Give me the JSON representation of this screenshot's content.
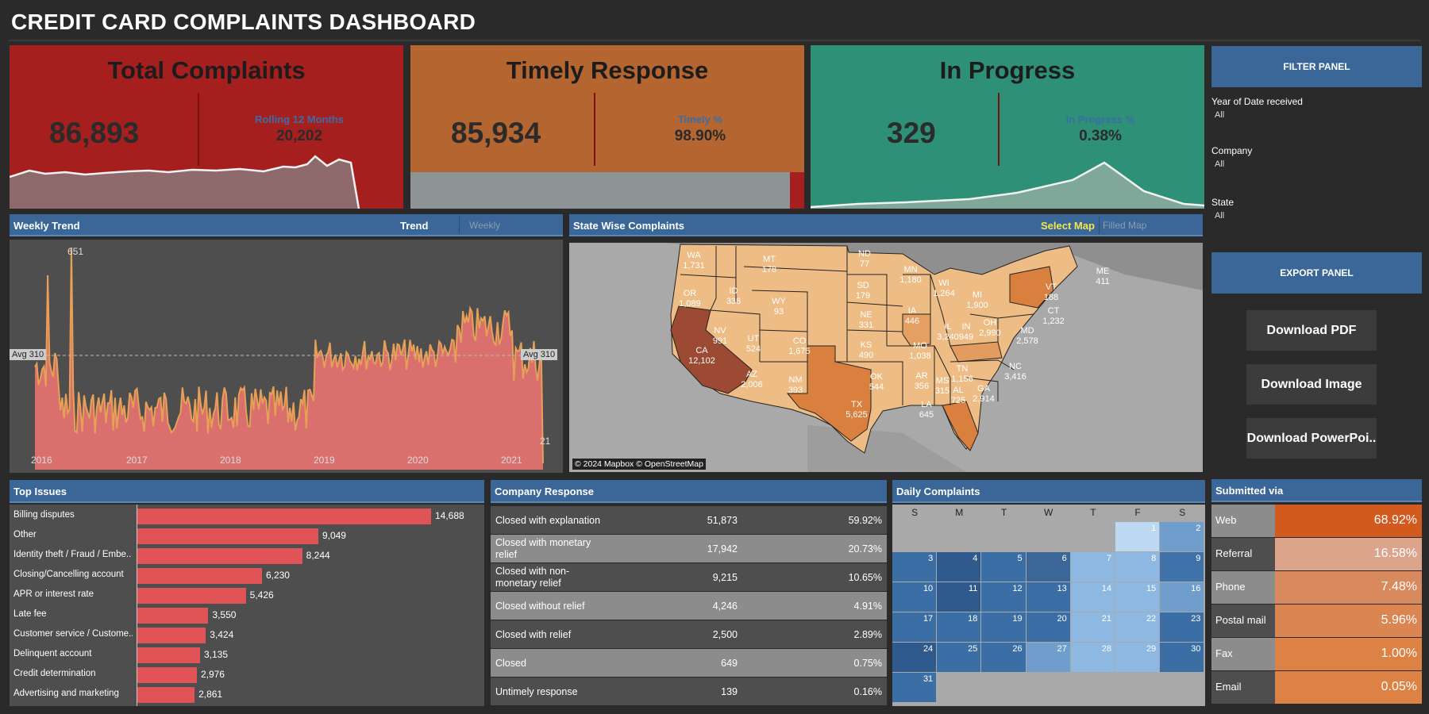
{
  "title": "CREDIT CARD COMPLAINTS DASHBOARD",
  "kpis": {
    "total": {
      "title": "Total Complaints",
      "value": "86,893",
      "sub_label": "Rolling 12 Months",
      "sub_value": "20,202",
      "color": "#a51f1f"
    },
    "timely": {
      "title": "Timely Response",
      "value": "85,934",
      "sub_label": "Timely %",
      "sub_value": "98.90%",
      "color": "#b5652f",
      "bar_fraction": 0.989
    },
    "progress": {
      "title": "In Progress",
      "value": "329",
      "sub_label": "In Progress %",
      "sub_value": "0.38%",
      "color": "#2e9076"
    }
  },
  "weekly": {
    "header": "Weekly Trend",
    "trend_label": "Trend",
    "trend_value": "Weekly",
    "peak_label": "651",
    "avg_label_left": "Avg 310",
    "avg_label_right": "Avg 310",
    "end_label": "21",
    "years": [
      "2016",
      "2017",
      "2018",
      "2019",
      "2020",
      "2021"
    ]
  },
  "state_map": {
    "header": "State Wise Complaints",
    "select_label": "Select Map",
    "select_value": "Filled Map",
    "attribution": "© 2024 Mapbox © OpenStreetMap",
    "states": [
      {
        "abbr": "WA",
        "value": "1,731"
      },
      {
        "abbr": "OR",
        "value": "1,089"
      },
      {
        "abbr": "CA",
        "value": "12,102"
      },
      {
        "abbr": "ID",
        "value": "336"
      },
      {
        "abbr": "NV",
        "value": "991"
      },
      {
        "abbr": "MT",
        "value": "178"
      },
      {
        "abbr": "WY",
        "value": "93"
      },
      {
        "abbr": "UT",
        "value": "524"
      },
      {
        "abbr": "AZ",
        "value": "2,006"
      },
      {
        "abbr": "CO",
        "value": "1,675"
      },
      {
        "abbr": "NM",
        "value": "393"
      },
      {
        "abbr": "ND",
        "value": "77"
      },
      {
        "abbr": "SD",
        "value": "179"
      },
      {
        "abbr": "NE",
        "value": "331"
      },
      {
        "abbr": "KS",
        "value": "490"
      },
      {
        "abbr": "OK",
        "value": "544"
      },
      {
        "abbr": "TX",
        "value": "5,625"
      },
      {
        "abbr": "MN",
        "value": "1,180"
      },
      {
        "abbr": "IA",
        "value": "446"
      },
      {
        "abbr": "MO",
        "value": "1,038"
      },
      {
        "abbr": "AR",
        "value": "356"
      },
      {
        "abbr": "LA",
        "value": "645"
      },
      {
        "abbr": "WI",
        "value": "1,264"
      },
      {
        "abbr": "IL",
        "value": "3,240"
      },
      {
        "abbr": "MI",
        "value": "1,900"
      },
      {
        "abbr": "IN",
        "value": "949"
      },
      {
        "abbr": "OH",
        "value": "2,990"
      },
      {
        "abbr": "TN",
        "value": "1,156"
      },
      {
        "abbr": "MS",
        "value": "315"
      },
      {
        "abbr": "AL",
        "value": "725"
      },
      {
        "abbr": "GA",
        "value": "2,914"
      },
      {
        "abbr": "NC",
        "value": "3,416"
      },
      {
        "abbr": "MD",
        "value": "2,578"
      },
      {
        "abbr": "VT",
        "value": "188"
      },
      {
        "abbr": "CT",
        "value": "1,232"
      },
      {
        "abbr": "ME",
        "value": "411"
      }
    ]
  },
  "filter_panel": {
    "header": "FILTER PANEL",
    "filters": [
      {
        "label": "Year of Date received",
        "value": "All"
      },
      {
        "label": "Company",
        "value": "All"
      },
      {
        "label": "State",
        "value": "All"
      }
    ]
  },
  "export_panel": {
    "header": "EXPORT PANEL",
    "buttons": [
      "Download PDF",
      "Download Image",
      "Download PowerPoi.."
    ]
  },
  "top_issues": {
    "header": "Top Issues",
    "rows": [
      {
        "label": "Billing disputes",
        "value": 14688,
        "text": "14,688"
      },
      {
        "label": "Other",
        "value": 9049,
        "text": "9,049"
      },
      {
        "label": "Identity theft / Fraud / Embe..",
        "value": 8244,
        "text": "8,244"
      },
      {
        "label": "Closing/Cancelling account",
        "value": 6230,
        "text": "6,230"
      },
      {
        "label": "APR or interest rate",
        "value": 5426,
        "text": "5,426"
      },
      {
        "label": "Late fee",
        "value": 3550,
        "text": "3,550"
      },
      {
        "label": "Customer service / Custome..",
        "value": 3424,
        "text": "3,424"
      },
      {
        "label": "Delinquent account",
        "value": 3135,
        "text": "3,135"
      },
      {
        "label": "Credit determination",
        "value": 2976,
        "text": "2,976"
      },
      {
        "label": "Advertising and marketing",
        "value": 2861,
        "text": "2,861"
      }
    ]
  },
  "company_response": {
    "header": "Company Response",
    "rows": [
      {
        "label": "Closed with explanation",
        "count": "51,873",
        "pct": "59.92%"
      },
      {
        "label": "Closed with monetary relief",
        "count": "17,942",
        "pct": "20.73%"
      },
      {
        "label": "Closed with non-monetary relief",
        "count": "9,215",
        "pct": "10.65%"
      },
      {
        "label": "Closed without relief",
        "count": "4,246",
        "pct": "4.91%"
      },
      {
        "label": "Closed with relief",
        "count": "2,500",
        "pct": "2.89%"
      },
      {
        "label": "Closed",
        "count": "649",
        "pct": "0.75%"
      },
      {
        "label": "Untimely response",
        "count": "139",
        "pct": "0.16%"
      }
    ]
  },
  "daily": {
    "header": "Daily Complaints",
    "weekdays": [
      "S",
      "M",
      "T",
      "W",
      "T",
      "F",
      "S"
    ],
    "days": [
      "1",
      "2",
      "3",
      "4",
      "5",
      "6",
      "7",
      "8",
      "9",
      "10",
      "11",
      "12",
      "13",
      "14",
      "15",
      "16",
      "17",
      "18",
      "19",
      "20",
      "21",
      "22",
      "23",
      "24",
      "25",
      "26",
      "27",
      "28",
      "29",
      "30",
      "31"
    ]
  },
  "submitted": {
    "header": "Submitted via",
    "rows": [
      {
        "label": "Web",
        "pct": "68.92%",
        "color": "#d35a1f"
      },
      {
        "label": "Referral",
        "pct": "16.58%",
        "color": "#dca48b"
      },
      {
        "label": "Phone",
        "pct": "7.48%",
        "color": "#d9895e"
      },
      {
        "label": "Postal mail",
        "pct": "5.96%",
        "color": "#da8552"
      },
      {
        "label": "Fax",
        "pct": "1.00%",
        "color": "#dc8244"
      },
      {
        "label": "Email",
        "pct": "0.05%",
        "color": "#dc8244"
      }
    ]
  }
}
